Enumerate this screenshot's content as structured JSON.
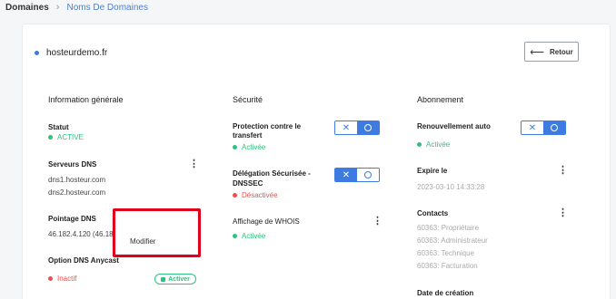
{
  "breadcrumb": {
    "root": "Domaines",
    "separator": "›",
    "current": "Noms De Domaines"
  },
  "domain": {
    "name": "hosteurdemo.fr"
  },
  "back_button": {
    "arrow": "⟵",
    "label": "Retour"
  },
  "general": {
    "title": "Information générale",
    "statut": {
      "label": "Statut",
      "value": "ACTIVE"
    },
    "serveurs_dns": {
      "label": "Serveurs DNS",
      "ns1": "dns1.hosteur.com",
      "ns2": "dns2.hosteur.com"
    },
    "pointage_dns": {
      "label": "Pointage DNS",
      "value": "46.182.4.120 (46.182."
    },
    "anycast": {
      "label": "Option DNS Anycast",
      "status": "Inactif",
      "button": "Activer"
    }
  },
  "security": {
    "title": "Sécurité",
    "transfer": {
      "label_line1": "Protection contre le",
      "label_line2": "transfert",
      "status": "Activée"
    },
    "dnssec": {
      "label_line1": "Délégation Sécurisée -",
      "label_line2": "DNSSEC",
      "status": "Désactivée"
    },
    "whois": {
      "label": "Affichage de WHOIS",
      "status": "Activée"
    }
  },
  "subscription": {
    "title": "Abonnement",
    "renewal": {
      "label": "Renouvellement auto",
      "status": "Activée"
    },
    "expires": {
      "label": "Expire le",
      "value": "2023-03-10 14:33:28"
    },
    "contacts": {
      "label": "Contacts",
      "items": [
        "60363: Propriétaire",
        "60363: Administrateur",
        "60363: Technique",
        "60363: Facturation"
      ]
    },
    "creation": {
      "label": "Date de création"
    }
  },
  "dropdown": {
    "item": "Modifier"
  },
  "icons": {
    "kebab": "kebab-menu-icon",
    "toggle_x": "✕",
    "lock": "lock-icon"
  },
  "colors": {
    "accent": "#3d7be0",
    "success": "#2ec27e",
    "danger": "#f04d4d",
    "highlight": "#e0001b"
  }
}
